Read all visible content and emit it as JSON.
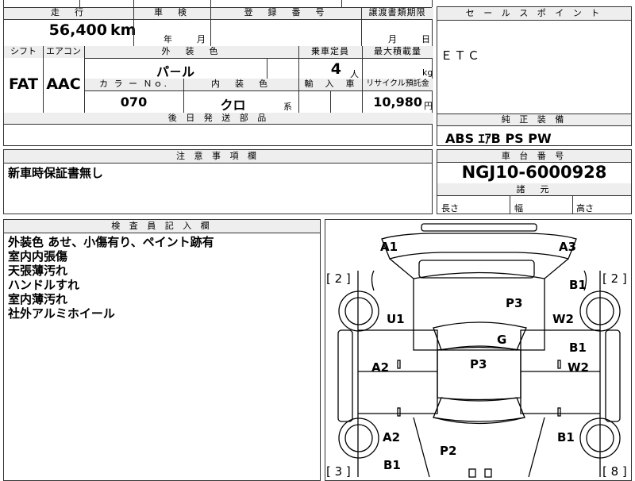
{
  "top_form": {
    "mileage_header": "走　行",
    "mileage_value": "56,400",
    "mileage_unit": "km",
    "inspection_header": "車　検",
    "inspection_year": "年",
    "inspection_month": "月",
    "registration_header": "登　録　番　号",
    "transfer_header": "譲渡書類期限",
    "transfer_month": "月",
    "transfer_day": "日",
    "shift_header": "シフト",
    "shift_value": "FAT",
    "ac_header": "エアコン",
    "ac_value": "AAC",
    "exterior_color_header": "外　装　色",
    "exterior_color_value": "パ－ル",
    "capacity_header": "乗車定員",
    "capacity_value": "4",
    "capacity_unit": "人",
    "max_load_header": "最大積載量",
    "max_load_unit": "kg",
    "color_no_header": "カ ラ ー Ｎｏ.",
    "color_no_value": "070",
    "interior_color_header": "内　装　色",
    "interior_color_value": "クロ",
    "interior_color_suffix": "系",
    "import_header": "輸　入　車",
    "recycle_header": "リサイクル預託金",
    "recycle_value": "10,980",
    "recycle_unit": "円",
    "later_parts_header": "後 日 発 送 部 品"
  },
  "sales_points": {
    "header": "セ ー ル ス ポ イ ン ト",
    "value": "ＥＴＣ"
  },
  "standard_equipment": {
    "header": "純 正 装 備",
    "value": "ABS ｴｱB PS PW"
  },
  "notes": {
    "header": "注 意 事 項 欄",
    "value": "新車時保証書無し"
  },
  "chassis": {
    "header": "車 台 番 号",
    "value": "NGJ10-6000928"
  },
  "dimensions": {
    "header": "諸　元",
    "length": "長さ",
    "width": "幅",
    "height": "高さ"
  },
  "inspector": {
    "header": "検 査 員 記 入 欄",
    "lines": [
      "外装色 あせ、小傷有り、ペイント跡有",
      "室内内張傷",
      "天張薄汚れ",
      "ハンドルすれ",
      "室内薄汚れ",
      "社外アルミホイール"
    ]
  },
  "diagram": {
    "tire_left_front": "[ 2 ]",
    "tire_right_front": "[ 2 ]",
    "tire_left_rear": "[ 3 ]",
    "tire_right_rear": "[ 8 ]",
    "marks": {
      "front_left_bumper": "A1",
      "front_right_bumper": "A3",
      "right_front_fender": "B1",
      "left_front_fender": "U1",
      "hood": "P3",
      "right_front_pillar": "W2",
      "windshield": "G",
      "roof": "P3",
      "right_front_door": "B1",
      "right_front_door_2": "W2",
      "left_front_door": "A2",
      "left_rear_fender": "A2",
      "right_rear_fender": "B1",
      "trunk": "P2",
      "left_rear_bumper": "B1"
    }
  }
}
